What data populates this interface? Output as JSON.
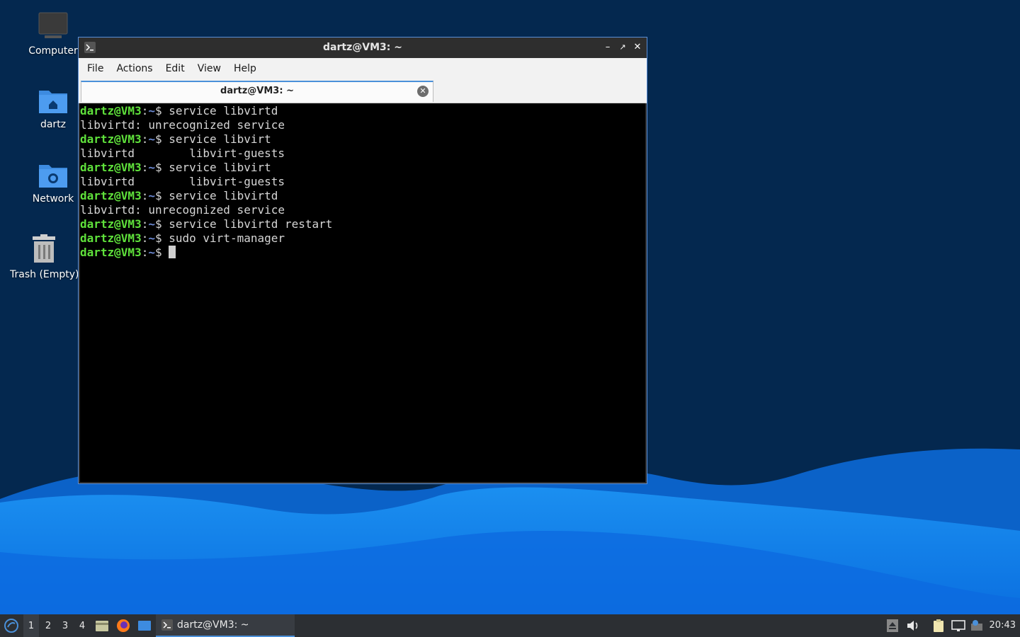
{
  "desktop": {
    "icons": [
      {
        "label": "Computer"
      },
      {
        "label": "dartz"
      },
      {
        "label": "Network"
      },
      {
        "label": "Trash (Empty)"
      }
    ]
  },
  "window": {
    "title": "dartz@VM3: ~",
    "menu": [
      "File",
      "Actions",
      "Edit",
      "View",
      "Help"
    ],
    "tab_label": "dartz@VM3: ~"
  },
  "terminal": {
    "prompt_user": "dartz@VM3",
    "prompt_sep": ":",
    "prompt_path": "~",
    "prompt_end": "$ ",
    "lines": [
      {
        "type": "cmd",
        "text": "service libvirtd"
      },
      {
        "type": "out",
        "text": "libvirtd: unrecognized service"
      },
      {
        "type": "cmd",
        "text": "service libvirt"
      },
      {
        "type": "out",
        "text": "libvirtd        libvirt-guests"
      },
      {
        "type": "cmd",
        "text": "service libvirt"
      },
      {
        "type": "out",
        "text": "libvirtd        libvirt-guests"
      },
      {
        "type": "cmd",
        "text": "service libvirtd"
      },
      {
        "type": "out",
        "text": "libvirtd: unrecognized service"
      },
      {
        "type": "cmd",
        "text": "service libvirtd restart"
      },
      {
        "type": "cmd",
        "text": "sudo virt-manager"
      },
      {
        "type": "cmd",
        "text": ""
      }
    ]
  },
  "taskbar": {
    "workspaces": [
      "1",
      "2",
      "3",
      "4"
    ],
    "active_workspace": "1",
    "task_label": "dartz@VM3: ~",
    "clock": "20:43"
  },
  "colors": {
    "accent": "#4a90d9",
    "prompt_user": "#5fe13b",
    "prompt_path": "#6d8bd6"
  }
}
